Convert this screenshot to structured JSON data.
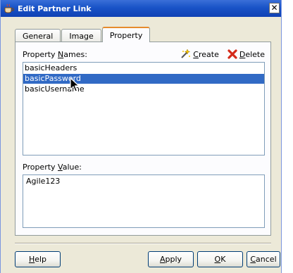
{
  "window": {
    "title": "Edit Partner Link",
    "close_glyph": "✕"
  },
  "tabs": [
    {
      "label": "General",
      "active": false
    },
    {
      "label": "Image",
      "active": false
    },
    {
      "label": "Property",
      "active": true
    }
  ],
  "property_names": {
    "label_prefix": "Property ",
    "label_mnemonic": "N",
    "label_suffix": "ames:",
    "create_label_mnemonic": "C",
    "create_label_rest": "reate",
    "delete_label_mnemonic": "D",
    "delete_label_rest": "elete",
    "items": [
      "basicHeaders",
      "basicPassword",
      "basicUsername"
    ],
    "selected_index": 1
  },
  "property_value": {
    "label_prefix": "Property ",
    "label_mnemonic": "V",
    "label_suffix": "alue:",
    "value": "Agile123"
  },
  "buttons": {
    "help_mnemonic": "H",
    "help_rest": "elp",
    "apply_mnemonic": "A",
    "apply_rest": "pply",
    "ok_mnemonic": "O",
    "ok_rest": "K",
    "cancel_mnemonic": "C",
    "cancel_rest": "ancel"
  },
  "icons": {
    "title": "coffee-cup-icon",
    "create": "sparkle-wand-icon",
    "delete": "red-x-icon"
  },
  "colors": {
    "titlebar": "#1953c7",
    "selection": "#316ac5",
    "delete_red": "#d42a1a",
    "tab_accent": "#e68b2c"
  }
}
